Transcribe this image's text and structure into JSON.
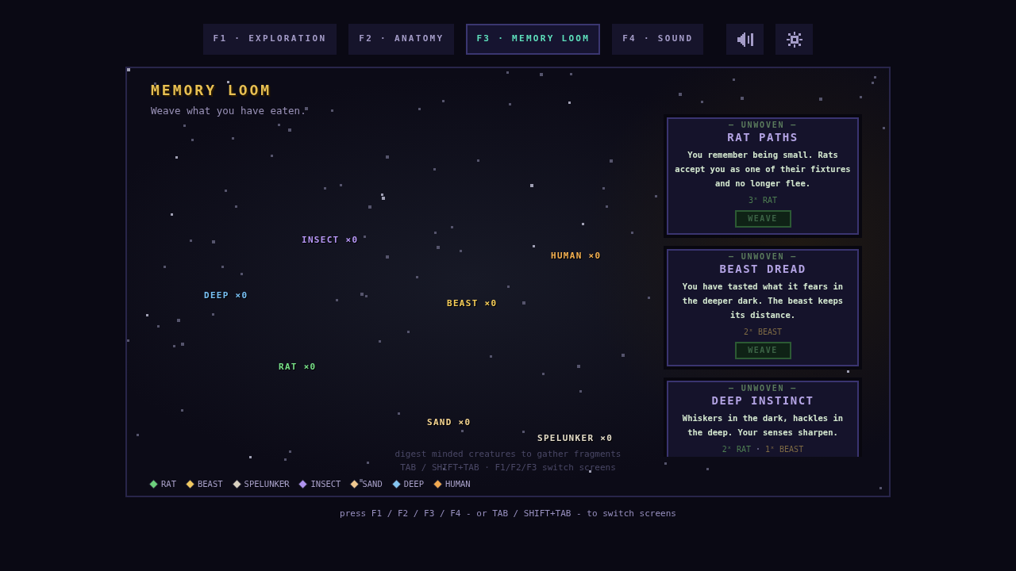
{
  "tabs": [
    {
      "label": "F1 · EXPLORATION",
      "selected": false
    },
    {
      "label": "F2 · ANATOMY",
      "selected": false
    },
    {
      "label": "F3 · MEMORY LOOM",
      "selected": true
    },
    {
      "label": "F4 · SOUND",
      "selected": false
    }
  ],
  "screen": {
    "title": "MEMORY LOOM",
    "subtitle": "Weave what you have eaten."
  },
  "map_nodes": [
    {
      "label": "INSECT ×0",
      "color": "#b898f8"
    },
    {
      "label": "HUMAN ×0",
      "color": "#f4b050"
    },
    {
      "label": "DEEP ×0",
      "color": "#78c0f4"
    },
    {
      "label": "BEAST ×0",
      "color": "#f4cc58"
    },
    {
      "label": "RAT ×0",
      "color": "#78e088"
    },
    {
      "label": "SAND ×0",
      "color": "#f4d490"
    },
    {
      "label": "SPELUNKER ×0",
      "color": "#e4dcc8"
    }
  ],
  "hints": [
    "digest minded creatures to gather fragments",
    "TAB / SHIFT+TAB · F1/F2/F3 switch screens"
  ],
  "legend": [
    {
      "label": "RAT",
      "color": "#6cd07c"
    },
    {
      "label": "BEAST",
      "color": "#f0c860"
    },
    {
      "label": "SPELUNKER",
      "color": "#d8d0c0"
    },
    {
      "label": "INSECT",
      "color": "#b094f0"
    },
    {
      "label": "SAND",
      "color": "#f0c890"
    },
    {
      "label": "DEEP",
      "color": "#84c4f0"
    },
    {
      "label": "HUMAN",
      "color": "#f0a850"
    }
  ],
  "cards": [
    {
      "status": "— UNWOVEN —",
      "title": "RAT PATHS",
      "description": "You remember being small. Rats accept you as one of their fixtures and no longer flee.",
      "cost": [
        {
          "kind": "item",
          "text": "3ˣ RAT",
          "color": "#4e7e52"
        }
      ],
      "button": {
        "label": "WEAVE",
        "disabled": true
      }
    },
    {
      "status": "— UNWOVEN —",
      "title": "BEAST DREAD",
      "description": "You have tasted what it fears in the deeper dark. The beast keeps its distance.",
      "cost": [
        {
          "kind": "item",
          "text": "2ˣ BEAST",
          "color": "#7e6a44"
        }
      ],
      "button": {
        "label": "WEAVE",
        "disabled": true
      }
    },
    {
      "status": "— UNWOVEN —",
      "title": "DEEP INSTINCT",
      "description": "Whiskers in the dark, hackles in the deep. Your senses sharpen.",
      "cost": [
        {
          "kind": "item",
          "text": "2ˣ RAT",
          "color": "#4e7e52"
        },
        {
          "kind": "separator",
          "text": "·"
        },
        {
          "kind": "item",
          "text": "1ˣ BEAST",
          "color": "#7e6a44"
        }
      ]
    }
  ],
  "footer": "press F1 / F2 / F3 / F4 - or TAB / SHIFT+TAB - to switch screens"
}
